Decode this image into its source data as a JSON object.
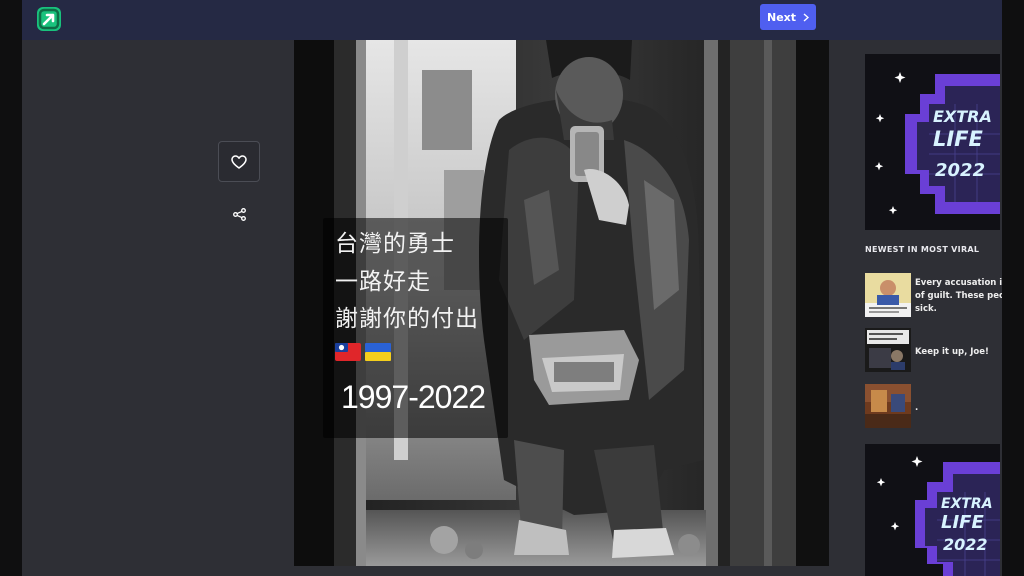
{
  "header": {
    "logo_icon": "imgur-style-arrow-logo",
    "next_label": "Next",
    "next_icon": "chevron-right-icon"
  },
  "actions": {
    "like_icon": "heart-icon",
    "share_icon": "share-icon"
  },
  "post": {
    "caption_lines": [
      "台灣的勇士",
      "一路好走",
      "謝謝你的付出"
    ],
    "flags": [
      "taiwan-flag",
      "ukraine-flag"
    ],
    "years": "1997-2022"
  },
  "sidebar": {
    "promo": {
      "lines": [
        "EXTRA",
        "LIFE",
        "2022"
      ],
      "accent": "#6a3fd6"
    },
    "section_title": "NEWEST IN MOST VIRAL",
    "items": [
      {
        "title_lines": [
          "Every accusation is",
          "of guilt. These peo",
          "sick."
        ]
      },
      {
        "title_lines": [
          "Keep it up, Joe!"
        ]
      },
      {
        "title_lines": [
          "."
        ]
      }
    ]
  },
  "colors": {
    "page_bg": "#2e2f35",
    "topbar_bg": "#252944",
    "next_button": "#4f5ff0",
    "logo": "#19c27d"
  }
}
